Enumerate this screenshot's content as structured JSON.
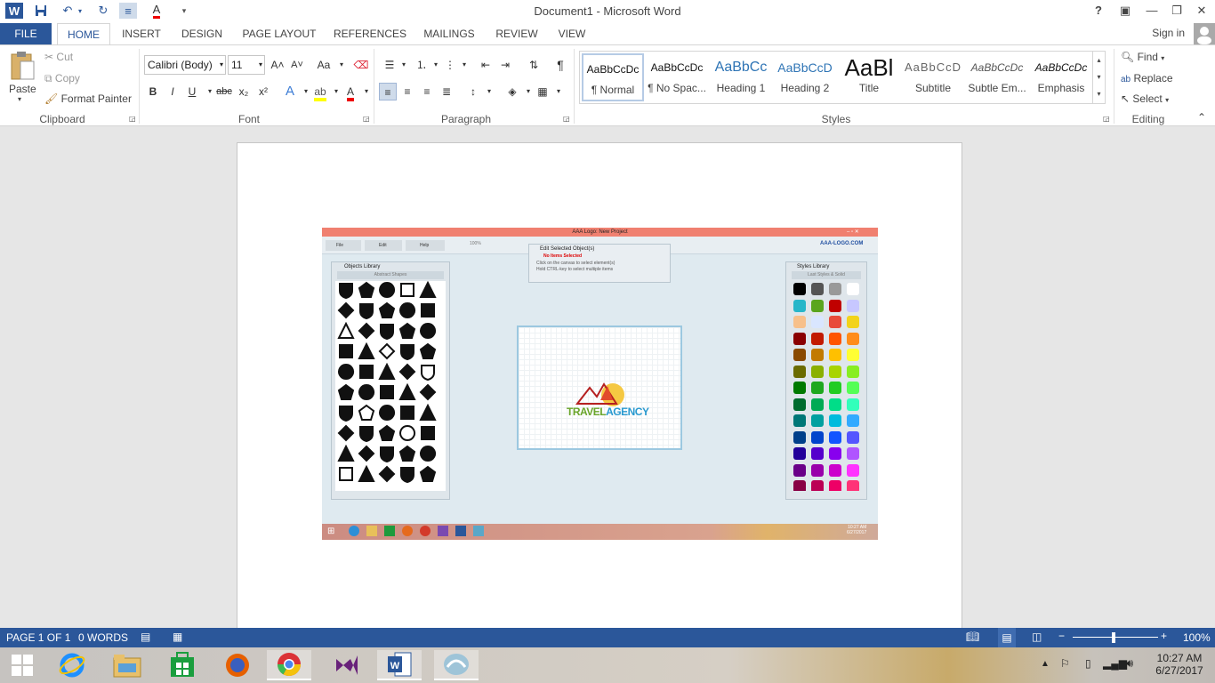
{
  "window": {
    "title": "Document1 - Microsoft Word",
    "help": "?"
  },
  "tabs": {
    "file": "FILE",
    "home": "HOME",
    "insert": "INSERT",
    "design": "DESIGN",
    "page_layout": "PAGE LAYOUT",
    "references": "REFERENCES",
    "mailings": "MAILINGS",
    "review": "REVIEW",
    "view": "VIEW",
    "signin": "Sign in"
  },
  "clipboard": {
    "paste": "Paste",
    "cut": "Cut",
    "copy": "Copy",
    "format_painter": "Format Painter",
    "group": "Clipboard"
  },
  "font": {
    "name": "Calibri (Body)",
    "size": "11",
    "case": "Aa",
    "bold": "B",
    "italic": "I",
    "underline": "U",
    "strike": "abc",
    "sub": "x₂",
    "sup": "x²",
    "group": "Font",
    "grow": "A˄",
    "shrink": "A˅"
  },
  "paragraph": {
    "group": "Paragraph",
    "pilcrow": "¶"
  },
  "styles": {
    "group": "Styles",
    "items": [
      {
        "sample": "AaBbCcDc",
        "name": "¶ Normal"
      },
      {
        "sample": "AaBbCcDc",
        "name": "¶ No Spac..."
      },
      {
        "sample": "AaBbCc",
        "name": "Heading 1"
      },
      {
        "sample": "AaBbCcD",
        "name": "Heading 2"
      },
      {
        "sample": "AaBl",
        "name": "Title"
      },
      {
        "sample": "AaBbCcD",
        "name": "Subtitle"
      },
      {
        "sample": "AaBbCcDc",
        "name": "Subtle Em..."
      },
      {
        "sample": "AaBbCcDc",
        "name": "Emphasis"
      }
    ]
  },
  "editing": {
    "find": "Find",
    "replace": "Replace",
    "select": "Select",
    "group": "Editing"
  },
  "embedded": {
    "title": "AAA Logo: New Project",
    "menu": [
      "File",
      "Edit",
      "Help"
    ],
    "zoom": "100%",
    "brand": "AAA-LOGO.COM",
    "edit_panel_title": "Edit Selected Object(s)",
    "no_items": "No Items Selected",
    "hint1": "Click on the canvas to select element(s)",
    "hint2": "Hold CTRL-key to select multiple items",
    "objects_title": "Objects Library",
    "objects_category": "Abstract Shapes",
    "styles_title": "Styles Library",
    "styles_category": "Last Styles & Solid",
    "logo_text_a": "TRAVEL",
    "logo_text_b": "AGENCY",
    "time": "10:27 AM",
    "date": "6/27/2017",
    "swatches": [
      "#000000",
      "#555555",
      "#999999",
      "#ffffff",
      "#27b6c9",
      "#5aa51e",
      "#c00000",
      "#c7c7ff",
      "#f7c08a",
      "#d9e6ff",
      "#e84a3a",
      "#f2d31b",
      "#8a0000",
      "#c21a00",
      "#ff5500",
      "#ff8c1a",
      "#8a4a00",
      "#c27a00",
      "#ffc000",
      "#ffff33",
      "#6b6b00",
      "#8ab000",
      "#a8d400",
      "#88ee22",
      "#007a00",
      "#1ea81e",
      "#22cc22",
      "#55ff55",
      "#006b2e",
      "#00aa55",
      "#00dd88",
      "#33ffbb",
      "#007777",
      "#00a0a0",
      "#00bbdd",
      "#33aaff",
      "#003f8a",
      "#0044cc",
      "#1155ff",
      "#5555ff",
      "#22009a",
      "#5500cc",
      "#8800ee",
      "#b055ff",
      "#6a0088",
      "#9900aa",
      "#cc00cc",
      "#ff33ff",
      "#880044",
      "#bb0055",
      "#ee0066",
      "#ff3377"
    ]
  },
  "status": {
    "page": "PAGE 1 OF 1",
    "words": "0 WORDS",
    "zoom": "100%"
  },
  "taskbar": {
    "time": "10:27 AM",
    "date": "6/27/2017"
  },
  "colors": {
    "word_blue": "#2b579a",
    "salmon": "#f08070"
  }
}
